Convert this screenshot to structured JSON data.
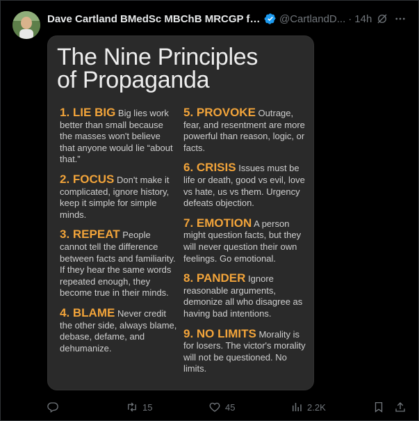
{
  "post": {
    "display_name": "Dave Cartland BMedSc MBChB MRCGP fr...",
    "handle": "@CartlandD...",
    "separator": "·",
    "time": "14h"
  },
  "image": {
    "title_line1": "The Nine Principles",
    "title_line2": "of Propaganda",
    "principles": [
      {
        "head": "1. LIE BIG",
        "text": " Big lies work better than small because the masses won't believe that anyone would lie “about that.”"
      },
      {
        "head": "2. FOCUS",
        "text": " Don't make it complicated, ignore history, keep it simple for simple minds."
      },
      {
        "head": "3. REPEAT",
        "text": " People cannot tell the difference between facts and familiarity. If they hear the same words repeated enough, they become true in their minds."
      },
      {
        "head": "4. BLAME",
        "text": " Never credit the other side, always blame, debase, defame, and dehumanize."
      },
      {
        "head": "5. PROVOKE",
        "text": " Outrage, fear, and resentment are more powerful than reason, logic, or facts."
      },
      {
        "head": "6. CRISIS",
        "text": " Issues must be life or death, good vs evil, love vs hate, us vs them. Urgency defeats objection."
      },
      {
        "head": "7. EMOTION",
        "text": " A person might question facts, but they will never question their own feelings. Go emotional."
      },
      {
        "head": "8. PANDER",
        "text": " Ignore reasonable arguments, demonize all who disagree as having bad intentions."
      },
      {
        "head": "9. NO LIMITS",
        "text": " Morality is for losers. The victor's morality will not be questioned. No limits."
      }
    ]
  },
  "actions": {
    "replies": "",
    "reposts": "15",
    "likes": "45",
    "views": "2.2K"
  },
  "icons": {
    "verified": "verified-badge-icon",
    "grok": "grok-icon",
    "more": "more-icon",
    "reply": "reply-icon",
    "repost": "repost-icon",
    "like": "like-icon",
    "views": "views-icon",
    "bookmark": "bookmark-icon",
    "share": "share-icon"
  },
  "colors": {
    "background": "#000000",
    "text": "#e7e9ea",
    "muted": "#71767b",
    "accent": "#1d9bf0",
    "principle_head": "#f2a43a"
  }
}
